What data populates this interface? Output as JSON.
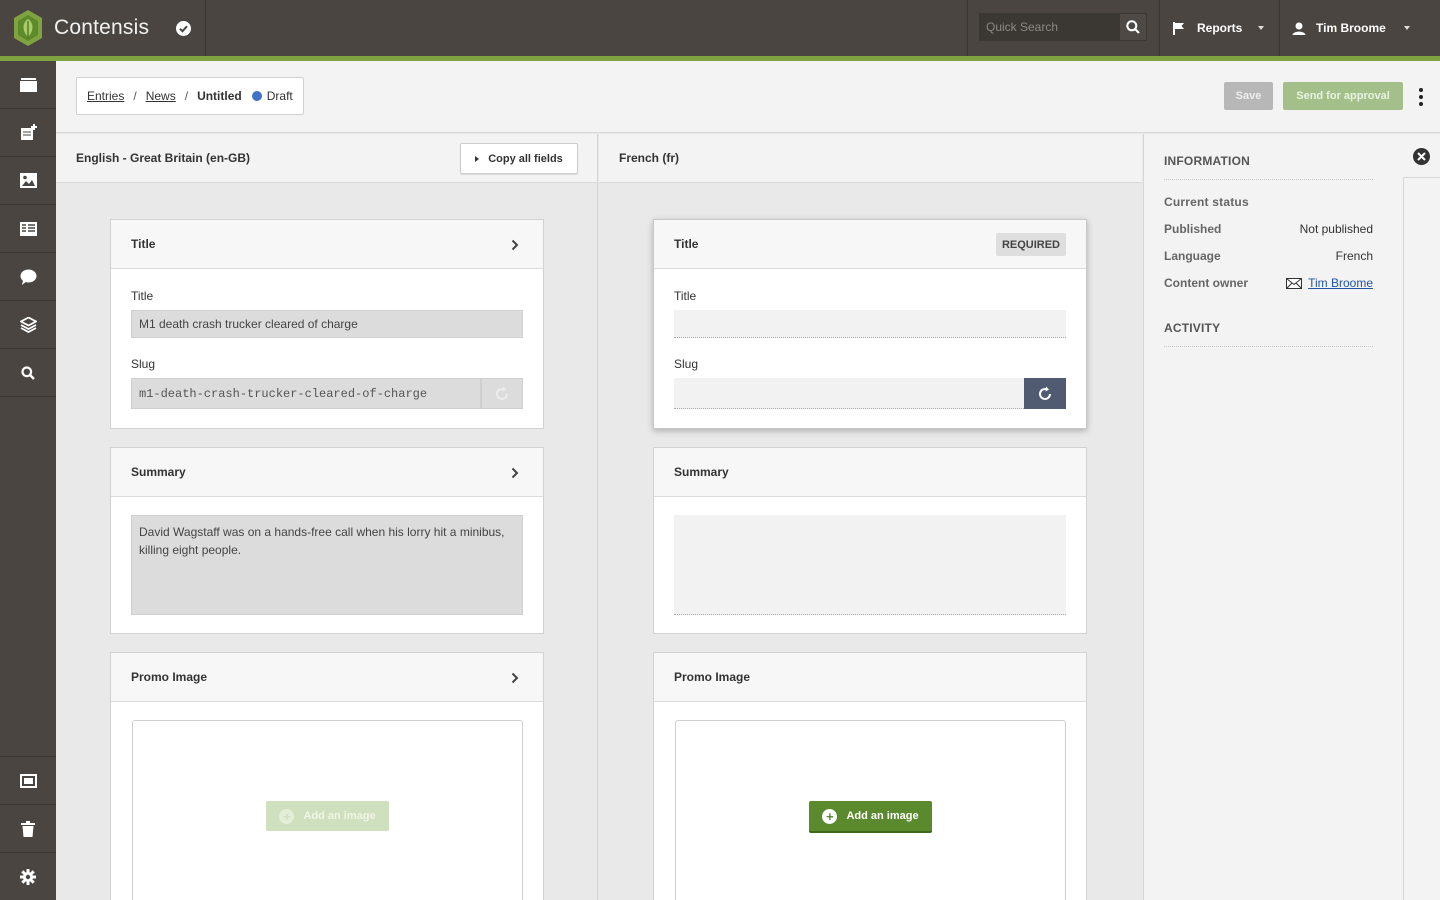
{
  "app": {
    "name": "Contensis"
  },
  "topbar": {
    "search_placeholder": "Quick Search",
    "reports_label": "Reports",
    "user_label": "Tim Broome"
  },
  "sidebar": {
    "items": [
      "folder-icon",
      "add-entry-icon",
      "image-icon",
      "list-icon",
      "comment-icon",
      "layers-icon",
      "search-icon"
    ],
    "bottom_items": [
      "window-icon",
      "trash-icon",
      "gear-icon"
    ]
  },
  "breadcrumb": {
    "entries": "Entries",
    "separator": "/",
    "news": "News",
    "current": "Untitled",
    "status": "Draft",
    "status_color": "#3f72c4"
  },
  "actions": {
    "save": "Save",
    "approve": "Send for approval"
  },
  "left_column": {
    "heading": "English - Great Britain (en-GB)",
    "copy_all": "Copy all fields",
    "title_card": {
      "title": "Title",
      "title_label": "Title",
      "title_value": "M1 death crash trucker cleared of charge",
      "slug_label": "Slug",
      "slug_value": "m1-death-crash-trucker-cleared-of-charge"
    },
    "summary_card": {
      "title": "Summary",
      "value": "David Wagstaff was on a hands-free call when his lorry hit a minibus, killing eight people."
    },
    "promo_card": {
      "title": "Promo Image",
      "add_image": "Add an image"
    }
  },
  "right_column": {
    "heading": "French (fr)",
    "title_card": {
      "title": "Title",
      "required": "REQUIRED",
      "title_label": "Title",
      "title_value": "",
      "slug_label": "Slug",
      "slug_value": ""
    },
    "summary_card": {
      "title": "Summary",
      "value": ""
    },
    "promo_card": {
      "title": "Promo Image",
      "add_image": "Add an image"
    }
  },
  "info_panel": {
    "information_heading": "INFORMATION",
    "current_status": "Current status",
    "published_key": "Published",
    "published_value": "Not published",
    "language_key": "Language",
    "language_value": "French",
    "owner_key": "Content owner",
    "owner_value": "Tim Broome",
    "activity_heading": "ACTIVITY"
  },
  "colors": {
    "topbar": "#4a4540",
    "accent_green": "#7fa341",
    "button_green": "#5b8a2e"
  }
}
